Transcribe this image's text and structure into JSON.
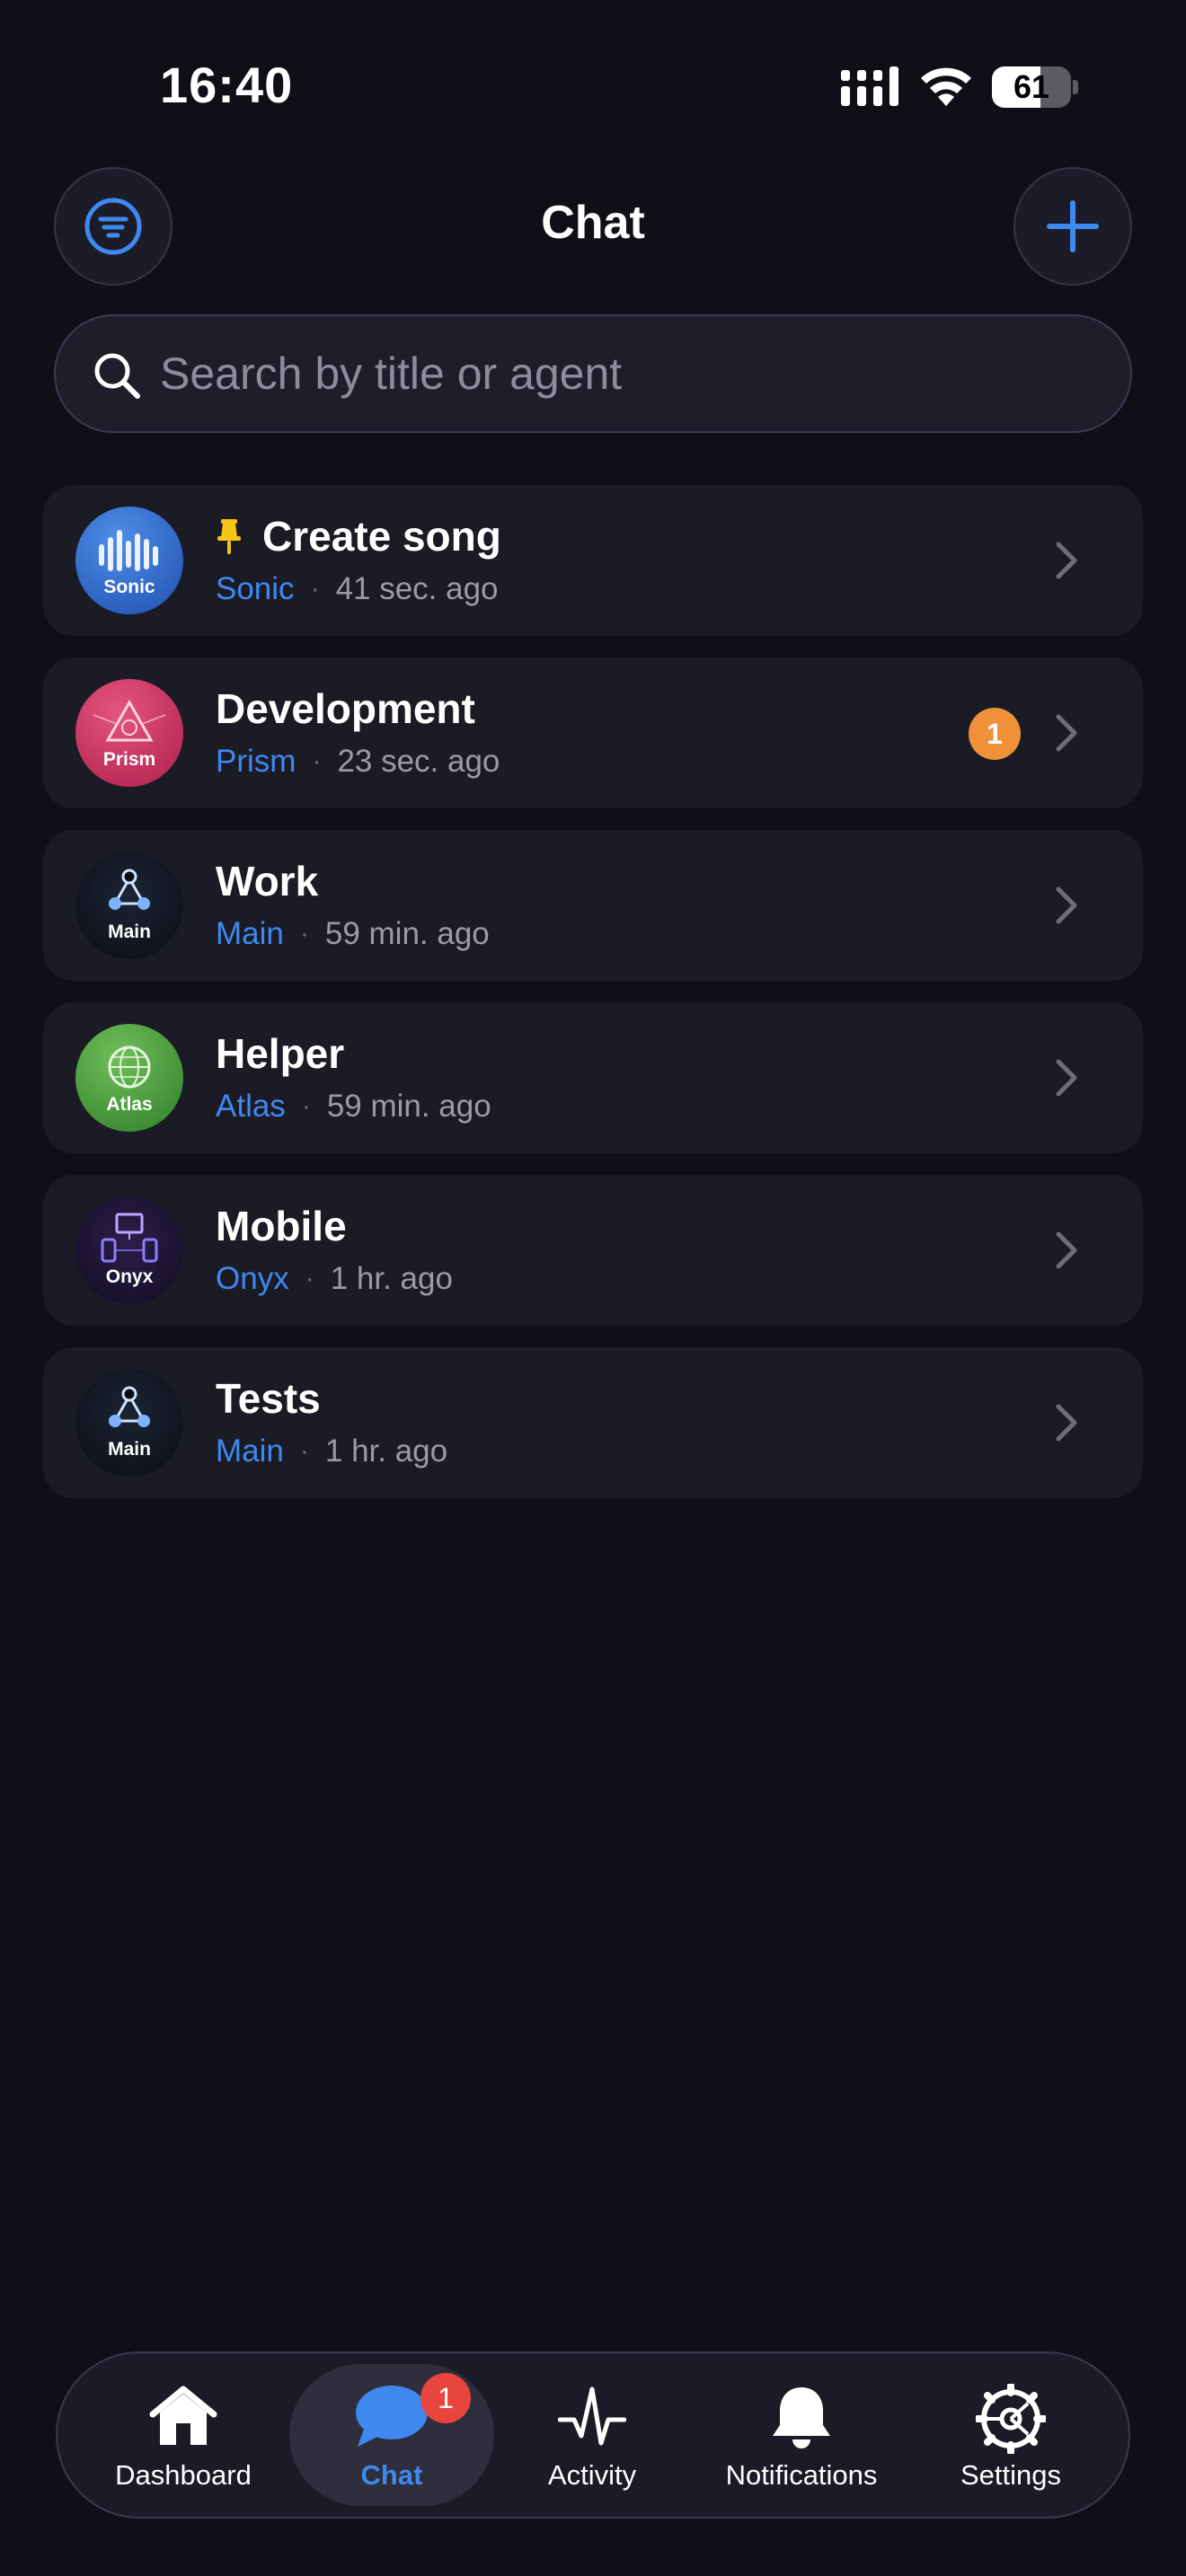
{
  "status_bar": {
    "time": "16:40",
    "battery": "61",
    "battery_level": 0.61
  },
  "header": {
    "title": "Chat",
    "filter_icon": "filter-icon",
    "add_icon": "plus-icon"
  },
  "search": {
    "placeholder": "Search by title or agent",
    "value": ""
  },
  "chats": [
    {
      "title": "Create song",
      "agent": "Sonic",
      "time": "41 sec. ago",
      "avatar_label": "Sonic",
      "pinned": true,
      "unread": ""
    },
    {
      "title": "Development",
      "agent": "Prism",
      "time": "23 sec. ago",
      "avatar_label": "Prism",
      "pinned": false,
      "unread": "1"
    },
    {
      "title": "Work",
      "agent": "Main",
      "time": "59 min. ago",
      "avatar_label": "Main",
      "pinned": false,
      "unread": ""
    },
    {
      "title": "Helper",
      "agent": "Atlas",
      "time": "59 min. ago",
      "avatar_label": "Atlas",
      "pinned": false,
      "unread": ""
    },
    {
      "title": "Mobile",
      "agent": "Onyx",
      "time": "1 hr. ago",
      "avatar_label": "Onyx",
      "pinned": false,
      "unread": ""
    },
    {
      "title": "Tests",
      "agent": "Main",
      "time": "1 hr. ago",
      "avatar_label": "Main",
      "pinned": false,
      "unread": ""
    }
  ],
  "tab_bar": {
    "items": [
      {
        "label": "Dashboard",
        "icon": "home-icon",
        "active": false,
        "badge": ""
      },
      {
        "label": "Chat",
        "icon": "chat-bubble-icon",
        "active": true,
        "badge": "1"
      },
      {
        "label": "Activity",
        "icon": "activity-icon",
        "active": false,
        "badge": ""
      },
      {
        "label": "Notifications",
        "icon": "bell-icon",
        "active": false,
        "badge": ""
      },
      {
        "label": "Settings",
        "icon": "gear-icon",
        "active": false,
        "badge": ""
      }
    ]
  },
  "colors": {
    "background": "#0f0f18",
    "card": "#1b1b26",
    "accent": "#3f88f0",
    "unread_badge": "#f0913a",
    "tab_badge": "#e8453c",
    "pin": "#f5c518"
  }
}
